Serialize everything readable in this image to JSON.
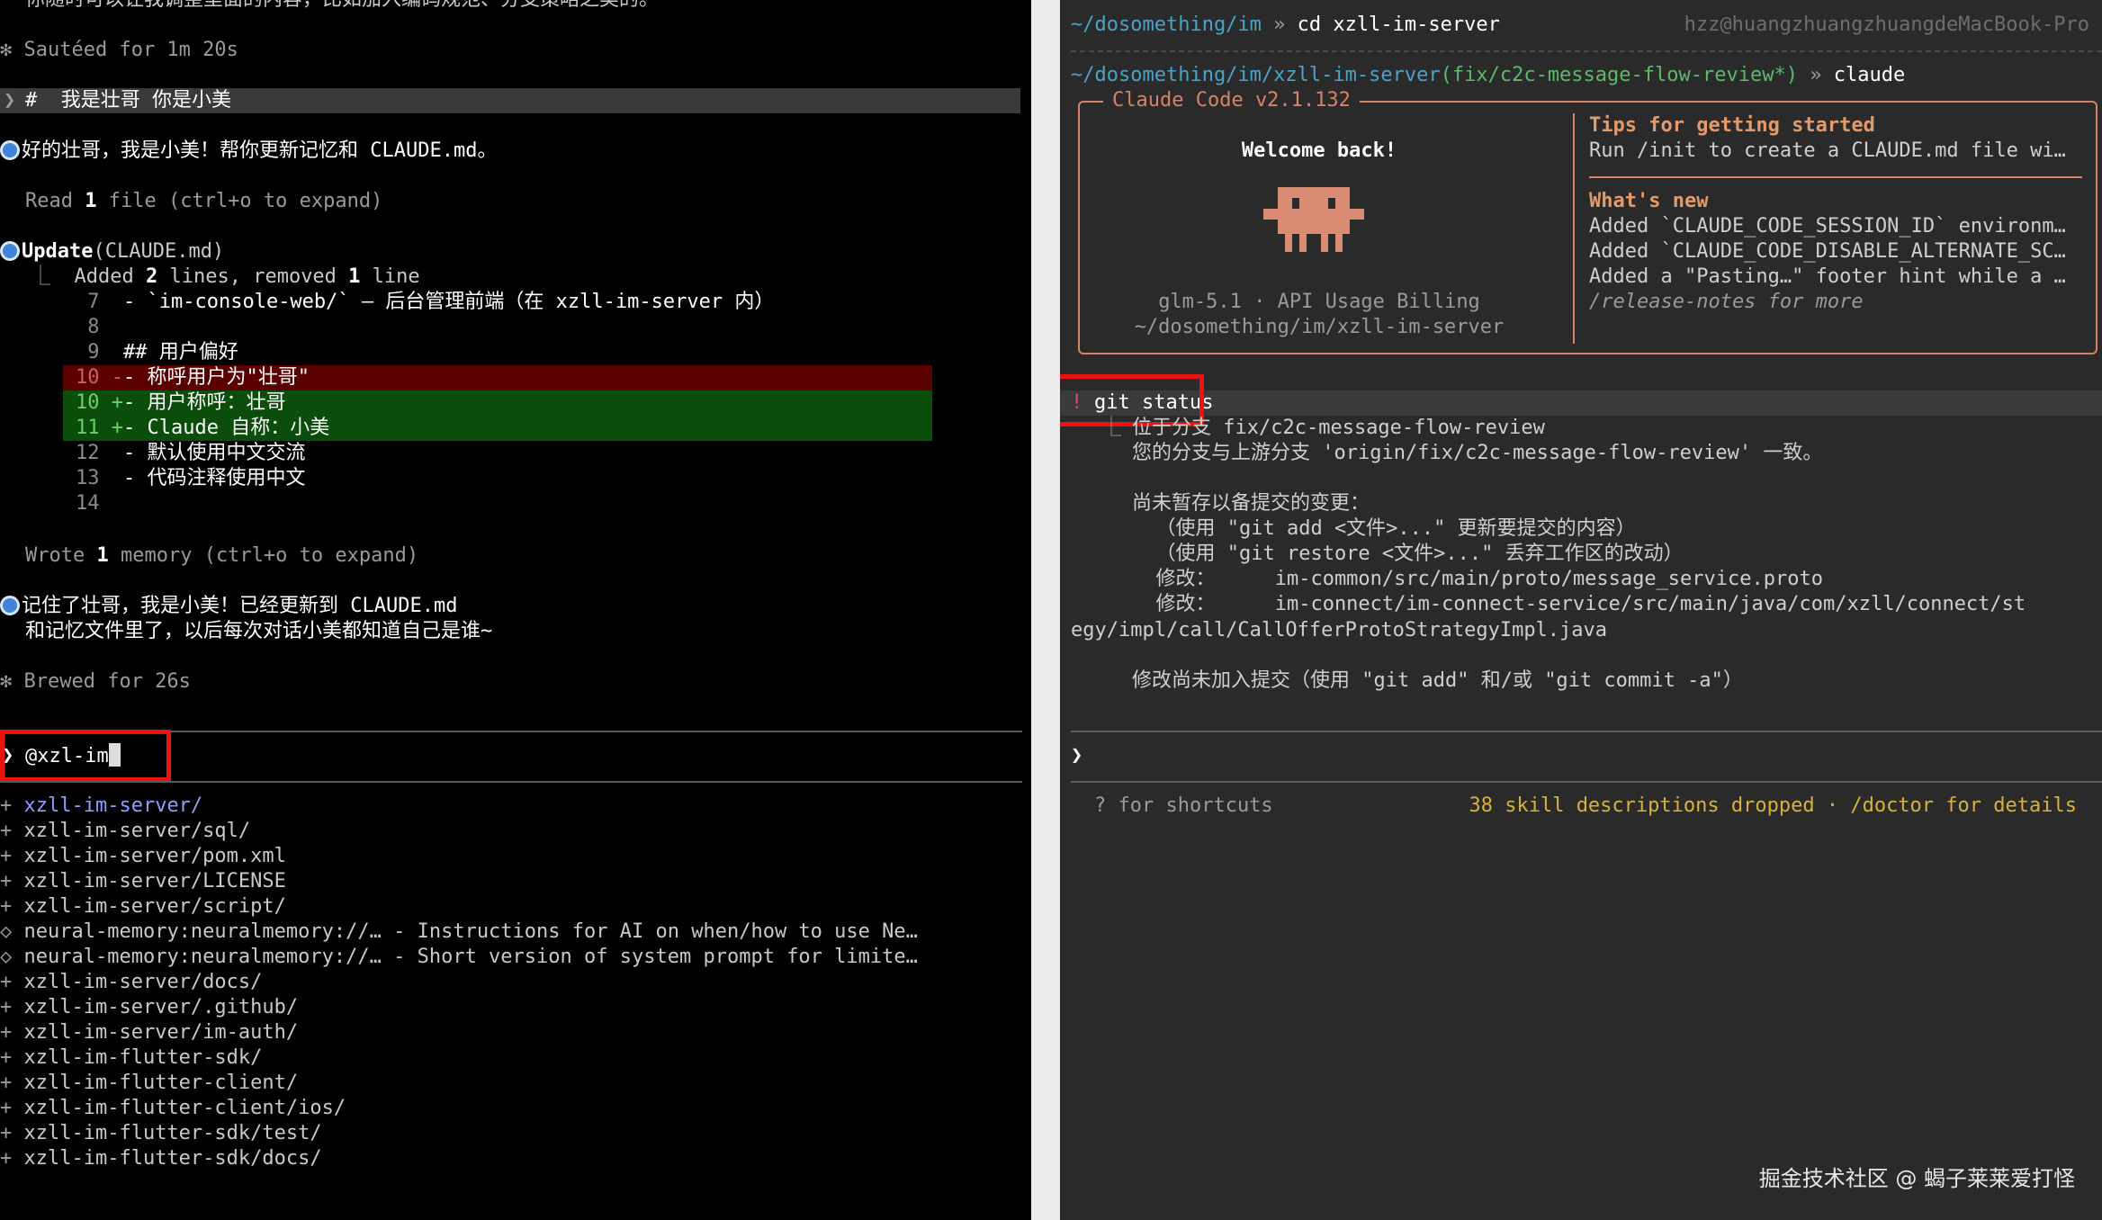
{
  "left": {
    "top_cut": "你随时可以让我调整里面的内容，比如加入编码规范、分支策略之类的。",
    "sauteed": "✻ Sautéed for 1m 20s",
    "user_prompt_mark": "❯",
    "user_prompt": "#  我是壮哥 你是小美",
    "reply1": "好的壮哥，我是小美！帮你更新记忆和 CLAUDE.md。",
    "read_pre": "Read ",
    "read_num": "1",
    "read_post": " file (ctrl+o to expand)",
    "update_tool": "Update",
    "update_arg": "(CLAUDE.md)",
    "update_branch": "⎿",
    "update_summary_a": "Added ",
    "update_summary_n1": "2",
    "update_summary_b": " lines, removed ",
    "update_summary_n2": "1",
    "update_summary_c": " line",
    "diff": [
      {
        "num": "7",
        "sign": " ",
        "text": "- `im-console-web/` — 后台管理前端（在 xzll-im-server 内）",
        "kind": "ctx"
      },
      {
        "num": "8",
        "sign": " ",
        "text": "",
        "kind": "ctx"
      },
      {
        "num": "9",
        "sign": " ",
        "text": "## 用户偏好",
        "kind": "ctx"
      },
      {
        "num": "10",
        "sign": "-",
        "text": "- 称呼用户为\"壮哥\"",
        "kind": "del"
      },
      {
        "num": "10",
        "sign": "+",
        "text": "- 用户称呼：壮哥",
        "kind": "add"
      },
      {
        "num": "11",
        "sign": "+",
        "text": "- Claude 自称：小美",
        "kind": "add"
      },
      {
        "num": "12",
        "sign": " ",
        "text": "- 默认使用中文交流",
        "kind": "ctx"
      },
      {
        "num": "13",
        "sign": " ",
        "text": "- 代码注释使用中文",
        "kind": "ctx"
      },
      {
        "num": "14",
        "sign": " ",
        "text": "",
        "kind": "ctx"
      }
    ],
    "wrote_pre": "Wrote ",
    "wrote_num": "1",
    "wrote_post": " memory (ctrl+o to expand)",
    "reply2_line1": "记住了壮哥，我是小美！已经更新到 CLAUDE.md",
    "reply2_line2": "和记忆文件里了，以后每次对话小美都知道自己是谁~",
    "brewed": "✻ Brewed for 26s",
    "input_prompt": "❯",
    "input_value": "@xzl-im",
    "suggestions": [
      {
        "mark": "+",
        "text": "xzll-im-server/",
        "selected": true
      },
      {
        "mark": "+",
        "text": "xzll-im-server/sql/",
        "selected": false
      },
      {
        "mark": "+",
        "text": "xzll-im-server/pom.xml",
        "selected": false
      },
      {
        "mark": "+",
        "text": "xzll-im-server/LICENSE",
        "selected": false
      },
      {
        "mark": "+",
        "text": "xzll-im-server/script/",
        "selected": false
      },
      {
        "mark": "◇",
        "text": "neural-memory:neuralmemory://… - Instructions for AI on when/how to use Ne…",
        "selected": false
      },
      {
        "mark": "◇",
        "text": "neural-memory:neuralmemory://… - Short version of system prompt for limite…",
        "selected": false
      },
      {
        "mark": "+",
        "text": "xzll-im-server/docs/",
        "selected": false
      },
      {
        "mark": "+",
        "text": "xzll-im-server/.github/",
        "selected": false
      },
      {
        "mark": "+",
        "text": "xzll-im-server/im-auth/",
        "selected": false
      },
      {
        "mark": "+",
        "text": "xzll-im-flutter-sdk/",
        "selected": false
      },
      {
        "mark": "+",
        "text": "xzll-im-flutter-client/",
        "selected": false
      },
      {
        "mark": "+",
        "text": "xzll-im-flutter-client/ios/",
        "selected": false
      },
      {
        "mark": "+",
        "text": "xzll-im-flutter-sdk/test/",
        "selected": false
      },
      {
        "mark": "+",
        "text": "xzll-im-flutter-sdk/docs/",
        "selected": false
      }
    ]
  },
  "right": {
    "cmd1_path": "~/dosomething/im",
    "cmd1_sep": " » ",
    "cmd1_cmd": "cd xzll-im-server",
    "host": "hzz@huangzhuangzhuangdeMacBook-Pro",
    "cmd2_path": "~/dosomething/im/xzll-im-server",
    "cmd2_branch": "(fix/c2c-message-flow-review*)",
    "cmd2_sep": " » ",
    "cmd2_cmd": "claude",
    "box_title": "Claude Code v2.1.132",
    "welcome": "Welcome back!",
    "model": "glm-5.1 · API Usage Billing",
    "cwd": "~/dosomething/im/xzll-im-server",
    "tips_title": "Tips for getting started",
    "tips_text": "Run /init to create a CLAUDE.md file wi…",
    "whats_new_title": "What's new",
    "news": [
      "Added `CLAUDE_CODE_SESSION_ID` environm…",
      "Added `CLAUDE_CODE_DISABLE_ALTERNATE_SC…",
      "Added a \"Pasting…\" footer hint while a …"
    ],
    "release_notes": "/release-notes for more",
    "bang": "!",
    "bash_cmd": "git status",
    "out_branch": "⎿",
    "git_output": [
      "位于分支 fix/c2c-message-flow-review",
      "您的分支与上游分支 'origin/fix/c2c-message-flow-review' 一致。",
      "",
      "尚未暂存以备提交的变更：",
      "  （使用 \"git add <文件>...\" 更新要提交的内容）",
      "  （使用 \"git restore <文件>...\" 丢弃工作区的改动）",
      "  修改：     im-common/src/main/proto/message_service.proto",
      "  修改：     im-connect/im-connect-service/src/main/java/com/xzll/connect/st"
    ],
    "git_wrap": "egy/impl/call/CallOfferProtoStrategyImpl.java",
    "git_tail": "修改尚未加入提交（使用 \"git add\" 和/或 \"git commit -a\"）",
    "input_prompt": "❯",
    "shortcuts": "? for shortcuts",
    "skills_warning": "38 skill descriptions dropped · /doctor for details"
  },
  "watermark": "掘金技术社区 @ 蝎子莱莱爱打怪"
}
